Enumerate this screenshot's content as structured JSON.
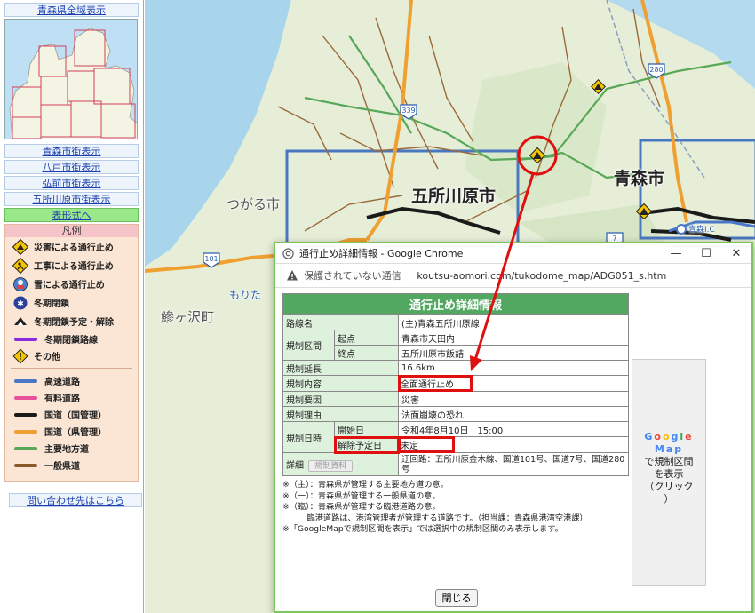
{
  "sidebar": {
    "all_area_link": "青森県全域表示",
    "city_links": [
      "青森市街表示",
      "八戸市街表示",
      "弘前市街表示",
      "五所川原市街表示"
    ],
    "table_format_link": "表形式へ",
    "legend": {
      "title": "凡例",
      "icon_items": [
        {
          "icon": "disaster-closure-icon",
          "label": "災害による通行止め"
        },
        {
          "icon": "construction-closure-icon",
          "label": "工事による通行止め"
        },
        {
          "icon": "snow-closure-icon",
          "label": "雪による通行止め"
        },
        {
          "icon": "winter-closure-icon",
          "label": "冬期閉鎖"
        },
        {
          "icon": "winter-closure-schedule-icon",
          "label": "冬期閉鎖予定・解除"
        },
        {
          "icon": "winter-closed-route-icon",
          "label": "冬期閉鎖路線"
        },
        {
          "icon": "other-icon",
          "label": "その他"
        }
      ],
      "line_items": [
        {
          "color": "#4a78c8",
          "label": "高速道路"
        },
        {
          "color": "#e8509a",
          "label": "有料道路"
        },
        {
          "color": "#1a1a1a",
          "label": "国道（国管理）"
        },
        {
          "color": "#f0a030",
          "label": "国道（県管理）"
        },
        {
          "color": "#58a858",
          "label": "主要地方道"
        },
        {
          "color": "#8b5a2b",
          "label": "一般県道"
        }
      ]
    },
    "contact_link": "問い合わせ先はこちら"
  },
  "map": {
    "labels": {
      "goshogawara": "五所川原市",
      "aomori": "青森市",
      "tsugaru": "つがる市",
      "ajigasawa": "鰺ヶ沢町",
      "morita": "もりた",
      "aomori_ic": "青森I.C"
    },
    "route_shields": [
      "339",
      "280",
      "101",
      "7"
    ]
  },
  "popup": {
    "window_title": "通行止め詳細情報 - Google Chrome",
    "insecure_text": "保護されていない通信",
    "url": "koutsu-aomori.com/tukodome_map/ADG051_s.htm",
    "table": {
      "header": "通行止め詳細情報",
      "route_name_label": "路線名",
      "route_name": "(主)青森五所川原線",
      "section_label": "規制区間",
      "start_label": "起点",
      "start": "青森市天田内",
      "end_label": "終点",
      "end": "五所川原市飯詰",
      "length_label": "規制延長",
      "length": "16.6km",
      "content_label": "規制内容",
      "content": "全面通行止め",
      "cause_label": "規制要因",
      "cause": "災害",
      "reason_label": "規制理由",
      "reason": "法面崩壊の恐れ",
      "datetime_label": "規制日時",
      "start_date_label": "開始日",
      "start_date": "令和4年8月10日　15:00",
      "release_date_label": "解除予定日",
      "release_date": "未定",
      "detail_label": "詳細",
      "material_button": "規制資料",
      "detour": "迂回路：五所川原金木線、国道101号、国道7号、国道280号"
    },
    "gmap_button": {
      "google": "Google",
      "map": "Map",
      "line1": "で規制区間",
      "line2": "を表示",
      "line3": "（クリック",
      "line4": "）"
    },
    "notes": [
      "※（主）：青森県が管理する主要地方道の意。",
      "※（一）：青森県が管理する一般県道の意。",
      "※（臨）：青森県が管理する臨港道路の意。",
      "　　　臨港道路は、港湾管理者が管理する道路です。（担当課：青森県港湾空港課）",
      "※「GoogleMapで規制区間を表示」では選択中の規制区間のみ表示します。"
    ],
    "close_button": "閉じる"
  },
  "colors": {
    "annotation": "#e01010",
    "table_header": "#52a860",
    "popup_border": "#7cc65c"
  }
}
